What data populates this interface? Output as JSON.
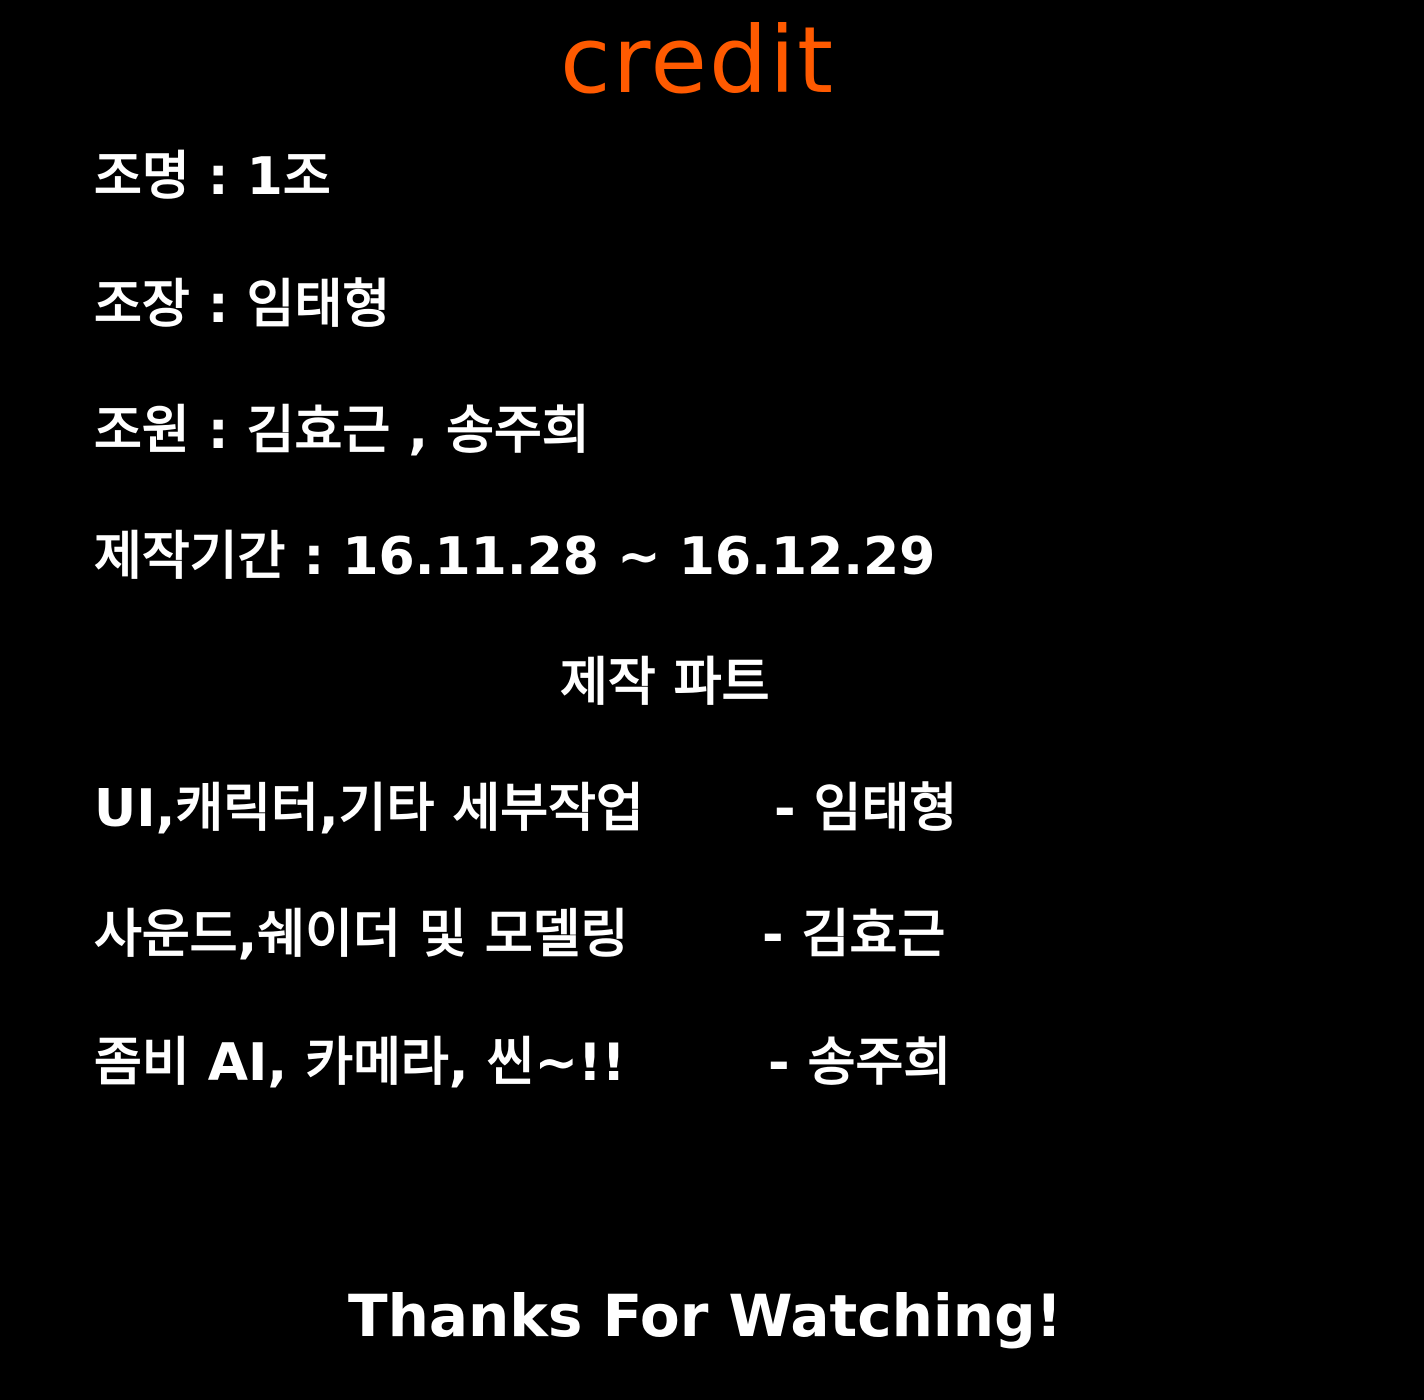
{
  "title": "credit",
  "info": [
    {
      "text": "조명 : 1조"
    },
    {
      "text": "조장 : 임태형"
    },
    {
      "text": "조원 : 김효근 , 송주희"
    },
    {
      "text": "제작기간 : 16.11.28 ~ 16.12.29"
    }
  ],
  "production": {
    "heading": "제작 파트",
    "rows": [
      {
        "role": "UI,캐릭터,기타 세부작업",
        "person": "- 임태형"
      },
      {
        "role": "사운드,쉐이더 및 모델링",
        "person": "- 김효근"
      },
      {
        "role": "좀비 AI, 카메라, 씬~!!",
        "person": "- 송주희"
      }
    ]
  },
  "footer": "Thanks For Watching!",
  "colors": {
    "background": "#000000",
    "title": "#ff5a00",
    "text": "#ffffff"
  }
}
